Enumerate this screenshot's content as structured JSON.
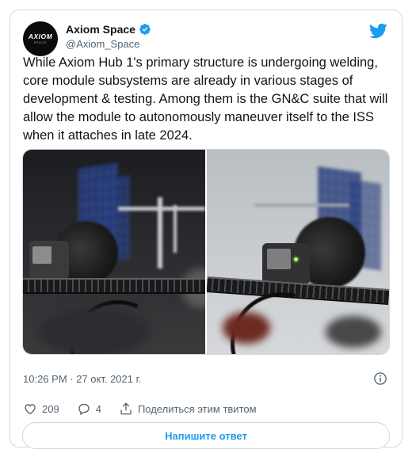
{
  "author": {
    "display_name": "Axiom Space",
    "handle": "@Axiom_Space",
    "avatar_logo": "AXIOM",
    "avatar_logo_sub": "SPACE",
    "verified": true
  },
  "tweet": {
    "text": "While Axiom Hub 1's primary structure is undergoing welding, core module subsystems are already in various stages of development & testing. Among them is the GN&C suite that will allow the module to autonomously maneuver itself to the ISS when it attaches in late 2024.",
    "timestamp": "10:26 PM · 27 окт. 2021 г."
  },
  "media": {
    "count": 2
  },
  "actions": {
    "like_count": "209",
    "reply_count": "4",
    "share_label": "Поделиться этим твитом"
  },
  "reply_button_label": "Напишите ответ",
  "colors": {
    "accent": "#1d9bf0",
    "muted_text": "#536471",
    "border": "#cfd9de"
  },
  "icons": {
    "verified": "verified-badge-icon",
    "bird": "twitter-bird-icon",
    "info": "info-icon",
    "like": "heart-icon",
    "reply": "comment-icon",
    "share": "share-icon"
  }
}
